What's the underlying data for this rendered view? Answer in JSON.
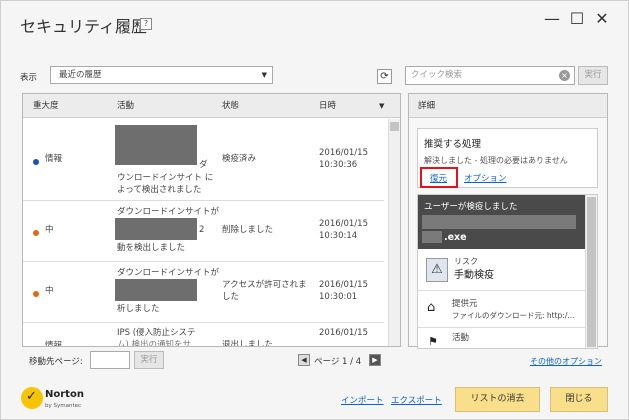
{
  "window": {
    "title": "セキュリティ履歴",
    "help_label": "?",
    "minimize_glyph": "—",
    "maximize_glyph": "☐",
    "close_glyph": "✕"
  },
  "filter": {
    "show_label": "表示",
    "selected": "最近の履歴",
    "search_placeholder": "クイック検索",
    "execute_label": "実行"
  },
  "table": {
    "columns": [
      "重大度",
      "活動",
      "状態",
      "日時"
    ],
    "rows": [
      {
        "severity": "情報",
        "severity_color": "#1f4fb4",
        "activity_tail": "ダ",
        "activity_lines": [
          "ウンロードインサイト に",
          "よって検出されました"
        ],
        "status": "検疫済み",
        "date": "2016/01/15",
        "time": "10:30:36"
      },
      {
        "severity": "中",
        "severity_color": "#e06a12",
        "activity_head": "ダウンロードインサイトが",
        "activity_tail": "2",
        "activity_line3": "動を検出しました",
        "status": "削除しました",
        "date": "2016/01/15",
        "time": "10:30:14"
      },
      {
        "severity": "中",
        "severity_color": "#e06a12",
        "activity_head": "ダウンロードインサイトが",
        "activity_line3": "析しました",
        "status_line1": "アクセスが許可されま",
        "status_line2": "した",
        "date": "2016/01/15",
        "time": "10:30:01"
      },
      {
        "severity": "情報",
        "severity_color": "#1f4fb4",
        "activity_head": "IPS (侵入防止システ",
        "activity_line2": "ム) 検出の通知をサ",
        "status": "退出しました",
        "date": "2016/01/15",
        "time": ""
      }
    ]
  },
  "pager": {
    "goto_label": "移動先ページ:",
    "execute_label": "実行",
    "page_label": "ページ 1 / 4",
    "prev_glyph": "◀",
    "next_glyph": "▶"
  },
  "details": {
    "header": "詳細",
    "recommended_title": "推奨する処理",
    "recommended_text": "解決しました - 処理の必要はありません",
    "restore_link": "復元",
    "options_link": "オプション",
    "user_detected": "ユーザーが検疫しました",
    "file_ext": ".exe",
    "risk_label": "リスク",
    "risk_value": "手動検疫",
    "source_label": "提供元",
    "source_value": "ファイルのダウンロード元: http:/...",
    "activity_label": "活動",
    "other_options": "その他のオプション"
  },
  "footer": {
    "brand": "Norton",
    "brand_sub": "by Symantec",
    "import_link": "インポート",
    "export_link": "エクスポート",
    "clear_list": "リストの消去",
    "close": "閉じる"
  },
  "colors": {
    "accent_yellow": "#f9df8c",
    "link_blue": "#0b63c5",
    "highlight_red": "#e0141e"
  }
}
